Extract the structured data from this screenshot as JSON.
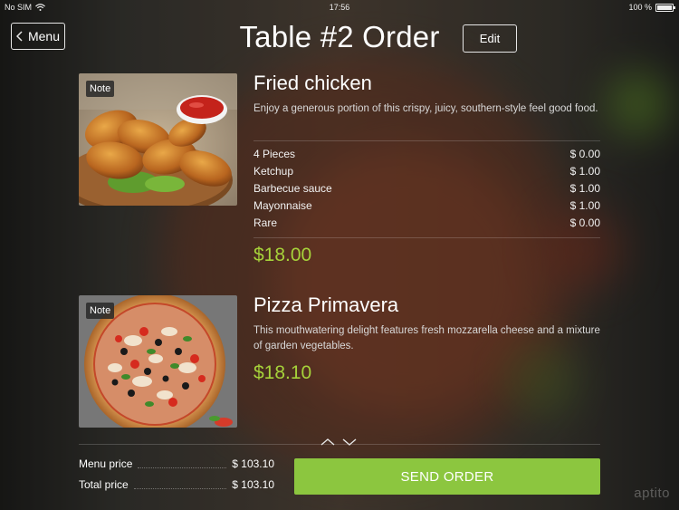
{
  "status_bar": {
    "carrier": "No SIM",
    "time": "17:56",
    "battery": "100 %"
  },
  "header": {
    "back_label": "Menu",
    "title": "Table #2 Order",
    "edit_label": "Edit"
  },
  "items": [
    {
      "name": "Fried chicken",
      "note_label": "Note",
      "description": " Enjoy a generous portion of this crispy, juicy, southern-style feel good food.",
      "modifiers": [
        {
          "label": "4 Pieces",
          "price": "$ 0.00"
        },
        {
          "label": "Ketchup",
          "price": "$ 1.00"
        },
        {
          "label": "Barbecue sauce",
          "price": "$ 1.00"
        },
        {
          "label": "Mayonnaise",
          "price": "$ 1.00"
        },
        {
          "label": "Rare",
          "price": "$ 0.00"
        }
      ],
      "price": "$18.00"
    },
    {
      "name": "Pizza Primavera",
      "note_label": "Note",
      "description": "This mouthwatering delight features fresh mozzarella cheese and a mixture of garden vegetables.",
      "price": "$18.10"
    }
  ],
  "scroll": {
    "up_icon": "chevron-up-icon",
    "down_icon": "chevron-down-icon"
  },
  "totals": {
    "menu_price_label": "Menu price",
    "menu_price": "$ 103.10",
    "total_price_label": "Total price",
    "total_price": "$ 103.10"
  },
  "send_label": "SEND ORDER",
  "brand": "aptito",
  "colors": {
    "accent": "#8cc63f",
    "price": "#a6d23a"
  }
}
